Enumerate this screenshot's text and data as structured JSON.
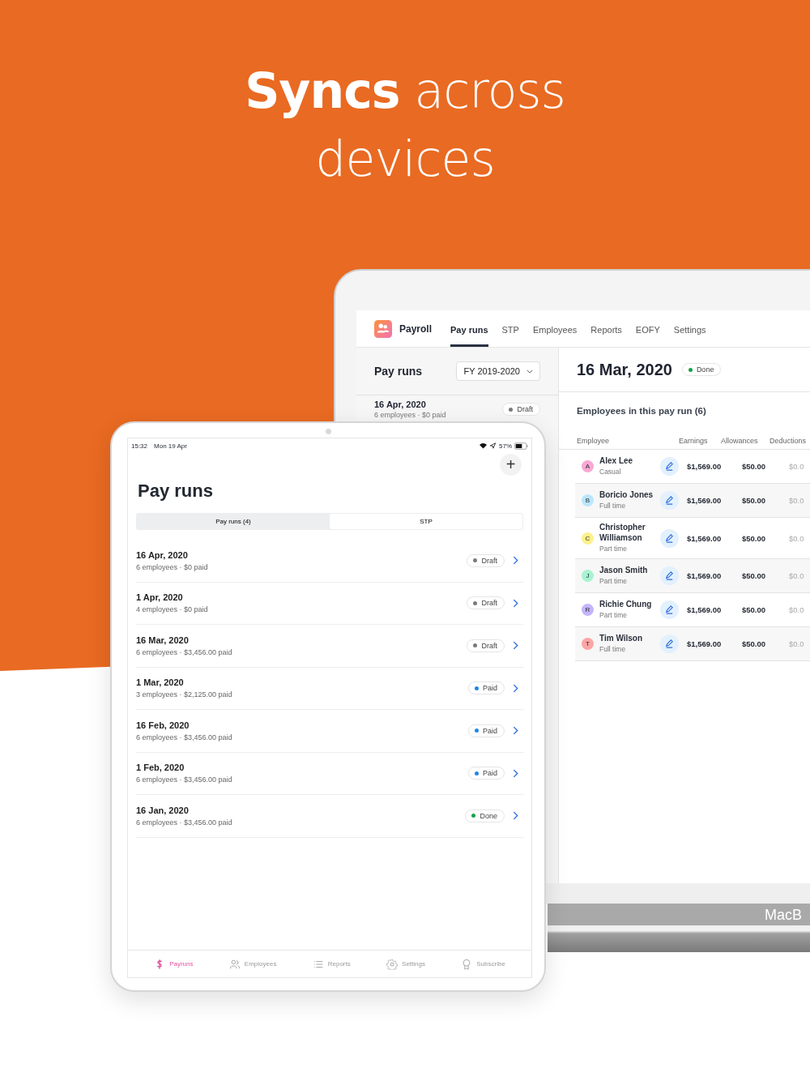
{
  "headline": "**Syncs** across devices",
  "laptop": {
    "brand_label": "MacB",
    "app_name": "Payroll",
    "nav": [
      {
        "label": "Pay runs",
        "selected": true
      },
      {
        "label": "STP",
        "selected": false
      },
      {
        "label": "Employees",
        "selected": false
      },
      {
        "label": "Reports",
        "selected": false
      },
      {
        "label": "EOFY",
        "selected": false
      },
      {
        "label": "Settings",
        "selected": false
      }
    ],
    "list_panel": {
      "title": "Pay runs",
      "period": "FY 2019-2020",
      "runs": [
        {
          "date": "16 Apr, 2020",
          "summary": "6 employees · $0 paid",
          "status": "Draft",
          "color": "#7a7a7a"
        }
      ]
    },
    "detail": {
      "date": "16 Mar, 2020",
      "status": "Done",
      "color": "#16a34a",
      "section_title": "Employees in this pay run (6)",
      "columns": [
        "Employee",
        "Earnings",
        "Allowances",
        "Deductions"
      ],
      "rows": [
        {
          "initial": "A",
          "color": "#f9a8d4",
          "name": "Alex Lee",
          "type": "Casual",
          "earnings": "$1,569.00",
          "allowances": "$50.00",
          "deductions": "$0.0"
        },
        {
          "initial": "B",
          "color": "#bae6fd",
          "name": "Boricio Jones",
          "type": "Full time",
          "earnings": "$1,569.00",
          "allowances": "$50.00",
          "deductions": "$0.0"
        },
        {
          "initial": "C",
          "color": "#fef08a",
          "name": "Christopher Williamson",
          "type": "Part time",
          "earnings": "$1,569.00",
          "allowances": "$50.00",
          "deductions": "$0.0"
        },
        {
          "initial": "J",
          "color": "#a7f3d0",
          "name": "Jason Smith",
          "type": "Part time",
          "earnings": "$1,569.00",
          "allowances": "$50.00",
          "deductions": "$0.0"
        },
        {
          "initial": "R",
          "color": "#c4b5fd",
          "name": "Richie Chung",
          "type": "Part time",
          "earnings": "$1,569.00",
          "allowances": "$50.00",
          "deductions": "$0.0"
        },
        {
          "initial": "T",
          "color": "#fca5a5",
          "name": "Tim Wilson",
          "type": "Full time",
          "earnings": "$1,569.00",
          "allowances": "$50.00",
          "deductions": "$0.0"
        }
      ]
    }
  },
  "tablet": {
    "time": "15:32",
    "date": "Mon 19 Apr",
    "battery": "57%",
    "add_button": "+",
    "title": "Pay runs",
    "segments": [
      {
        "label": "Pay runs (4)",
        "selected": true
      },
      {
        "label": "STP",
        "selected": false
      }
    ],
    "runs": [
      {
        "date": "16 Apr, 2020",
        "summary": "6 employees · $0 paid",
        "status": "Draft",
        "color": "#7a7a7a"
      },
      {
        "date": "1 Apr, 2020",
        "summary": "4 employees · $0 paid",
        "status": "Draft",
        "color": "#7a7a7a"
      },
      {
        "date": "16 Mar, 2020",
        "summary": "6 employees · $3,456.00 paid",
        "status": "Draft",
        "color": "#7a7a7a"
      },
      {
        "date": "1 Mar, 2020",
        "summary": "3 employees · $2,125.00 paid",
        "status": "Paid",
        "color": "#1e88e5"
      },
      {
        "date": "16 Feb, 2020",
        "summary": "6 employees · $3,456.00 paid",
        "status": "Paid",
        "color": "#1e88e5"
      },
      {
        "date": "1 Feb, 2020",
        "summary": "6 employees · $3,456.00 paid",
        "status": "Paid",
        "color": "#1e88e5"
      },
      {
        "date": "16 Jan, 2020",
        "summary": "6 employees · $3,456.00 paid",
        "status": "Done",
        "color": "#16a34a"
      }
    ],
    "tab_bar": [
      {
        "kind": "dollar",
        "label": "Payruns",
        "selected": true
      },
      {
        "kind": "people",
        "label": "Employees",
        "selected": false
      },
      {
        "kind": "list",
        "label": "Reports",
        "selected": false
      },
      {
        "kind": "gear",
        "label": "Settings",
        "selected": false
      },
      {
        "kind": "award",
        "label": "Subscribe",
        "selected": false
      }
    ]
  }
}
